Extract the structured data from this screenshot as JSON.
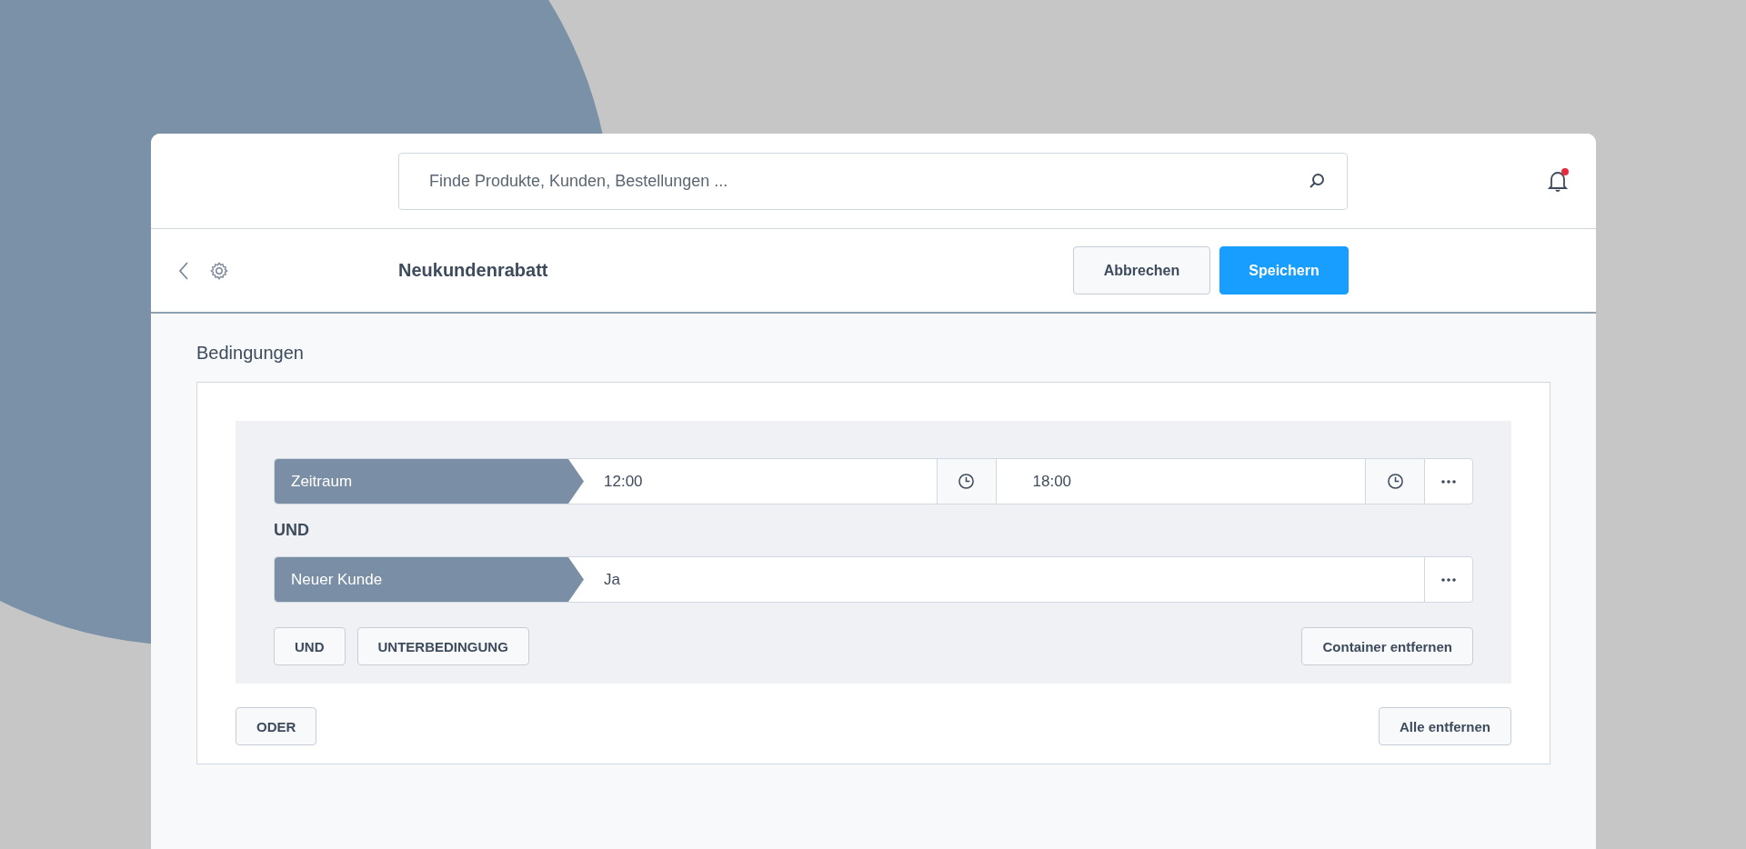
{
  "search": {
    "placeholder": "Finde Produkte, Kunden, Bestellungen ..."
  },
  "notifications": {
    "unread": true
  },
  "toolbar": {
    "title": "Neukundenrabatt",
    "cancel": "Abbrechen",
    "save": "Speichern"
  },
  "section": {
    "title": "Bedingungen"
  },
  "container": {
    "conditions": [
      {
        "kind": "timerange",
        "label": "Zeitraum",
        "from": "12:00",
        "to": "18:00"
      },
      {
        "kind": "value",
        "label": "Neuer Kunde",
        "value": "Ja"
      }
    ],
    "connector": "UND",
    "buttons": [
      "UND",
      "UNTERBEDINGUNG"
    ],
    "remove": "Container entfernen"
  },
  "or_button": "ODER",
  "remove_all": "Alle entfernen"
}
